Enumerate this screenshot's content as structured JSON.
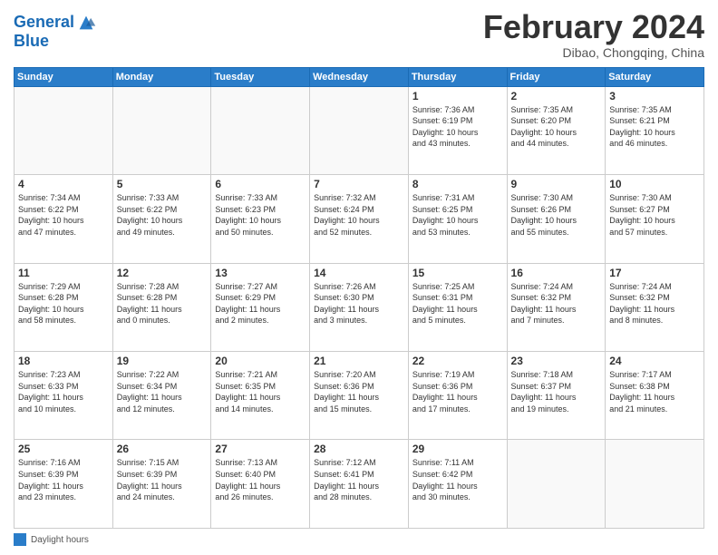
{
  "header": {
    "logo_line1": "General",
    "logo_line2": "Blue",
    "month_title": "February 2024",
    "subtitle": "Dibao, Chongqing, China"
  },
  "weekdays": [
    "Sunday",
    "Monday",
    "Tuesday",
    "Wednesday",
    "Thursday",
    "Friday",
    "Saturday"
  ],
  "legend": {
    "label": "Daylight hours"
  },
  "weeks": [
    [
      {
        "day": "",
        "info": ""
      },
      {
        "day": "",
        "info": ""
      },
      {
        "day": "",
        "info": ""
      },
      {
        "day": "",
        "info": ""
      },
      {
        "day": "1",
        "info": "Sunrise: 7:36 AM\nSunset: 6:19 PM\nDaylight: 10 hours\nand 43 minutes."
      },
      {
        "day": "2",
        "info": "Sunrise: 7:35 AM\nSunset: 6:20 PM\nDaylight: 10 hours\nand 44 minutes."
      },
      {
        "day": "3",
        "info": "Sunrise: 7:35 AM\nSunset: 6:21 PM\nDaylight: 10 hours\nand 46 minutes."
      }
    ],
    [
      {
        "day": "4",
        "info": "Sunrise: 7:34 AM\nSunset: 6:22 PM\nDaylight: 10 hours\nand 47 minutes."
      },
      {
        "day": "5",
        "info": "Sunrise: 7:33 AM\nSunset: 6:22 PM\nDaylight: 10 hours\nand 49 minutes."
      },
      {
        "day": "6",
        "info": "Sunrise: 7:33 AM\nSunset: 6:23 PM\nDaylight: 10 hours\nand 50 minutes."
      },
      {
        "day": "7",
        "info": "Sunrise: 7:32 AM\nSunset: 6:24 PM\nDaylight: 10 hours\nand 52 minutes."
      },
      {
        "day": "8",
        "info": "Sunrise: 7:31 AM\nSunset: 6:25 PM\nDaylight: 10 hours\nand 53 minutes."
      },
      {
        "day": "9",
        "info": "Sunrise: 7:30 AM\nSunset: 6:26 PM\nDaylight: 10 hours\nand 55 minutes."
      },
      {
        "day": "10",
        "info": "Sunrise: 7:30 AM\nSunset: 6:27 PM\nDaylight: 10 hours\nand 57 minutes."
      }
    ],
    [
      {
        "day": "11",
        "info": "Sunrise: 7:29 AM\nSunset: 6:28 PM\nDaylight: 10 hours\nand 58 minutes."
      },
      {
        "day": "12",
        "info": "Sunrise: 7:28 AM\nSunset: 6:28 PM\nDaylight: 11 hours\nand 0 minutes."
      },
      {
        "day": "13",
        "info": "Sunrise: 7:27 AM\nSunset: 6:29 PM\nDaylight: 11 hours\nand 2 minutes."
      },
      {
        "day": "14",
        "info": "Sunrise: 7:26 AM\nSunset: 6:30 PM\nDaylight: 11 hours\nand 3 minutes."
      },
      {
        "day": "15",
        "info": "Sunrise: 7:25 AM\nSunset: 6:31 PM\nDaylight: 11 hours\nand 5 minutes."
      },
      {
        "day": "16",
        "info": "Sunrise: 7:24 AM\nSunset: 6:32 PM\nDaylight: 11 hours\nand 7 minutes."
      },
      {
        "day": "17",
        "info": "Sunrise: 7:24 AM\nSunset: 6:32 PM\nDaylight: 11 hours\nand 8 minutes."
      }
    ],
    [
      {
        "day": "18",
        "info": "Sunrise: 7:23 AM\nSunset: 6:33 PM\nDaylight: 11 hours\nand 10 minutes."
      },
      {
        "day": "19",
        "info": "Sunrise: 7:22 AM\nSunset: 6:34 PM\nDaylight: 11 hours\nand 12 minutes."
      },
      {
        "day": "20",
        "info": "Sunrise: 7:21 AM\nSunset: 6:35 PM\nDaylight: 11 hours\nand 14 minutes."
      },
      {
        "day": "21",
        "info": "Sunrise: 7:20 AM\nSunset: 6:36 PM\nDaylight: 11 hours\nand 15 minutes."
      },
      {
        "day": "22",
        "info": "Sunrise: 7:19 AM\nSunset: 6:36 PM\nDaylight: 11 hours\nand 17 minutes."
      },
      {
        "day": "23",
        "info": "Sunrise: 7:18 AM\nSunset: 6:37 PM\nDaylight: 11 hours\nand 19 minutes."
      },
      {
        "day": "24",
        "info": "Sunrise: 7:17 AM\nSunset: 6:38 PM\nDaylight: 11 hours\nand 21 minutes."
      }
    ],
    [
      {
        "day": "25",
        "info": "Sunrise: 7:16 AM\nSunset: 6:39 PM\nDaylight: 11 hours\nand 23 minutes."
      },
      {
        "day": "26",
        "info": "Sunrise: 7:15 AM\nSunset: 6:39 PM\nDaylight: 11 hours\nand 24 minutes."
      },
      {
        "day": "27",
        "info": "Sunrise: 7:13 AM\nSunset: 6:40 PM\nDaylight: 11 hours\nand 26 minutes."
      },
      {
        "day": "28",
        "info": "Sunrise: 7:12 AM\nSunset: 6:41 PM\nDaylight: 11 hours\nand 28 minutes."
      },
      {
        "day": "29",
        "info": "Sunrise: 7:11 AM\nSunset: 6:42 PM\nDaylight: 11 hours\nand 30 minutes."
      },
      {
        "day": "",
        "info": ""
      },
      {
        "day": "",
        "info": ""
      }
    ]
  ]
}
